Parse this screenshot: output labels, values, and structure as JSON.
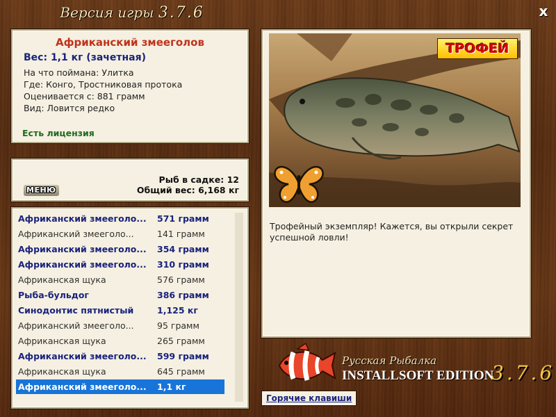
{
  "window": {
    "title": "Версия игры",
    "version": "3.7.6",
    "close_label": "x"
  },
  "fish_card": {
    "name": "Африканский змееголов",
    "weight": "Вес: 1,1 кг (зачетная)",
    "caught_on": "На что поймана: Улитка",
    "location": "Где: Конго, Тростниковая протока",
    "scored_from": "Оценивается с: 881 грамм",
    "kind": "Вид: Ловится редко",
    "license": "Есть лицензия"
  },
  "keepnet": {
    "menu_label": "МЕНЮ",
    "fish_count": "Рыб в садке: 12",
    "total_weight": "Общий вес: 6,168 кг"
  },
  "catch_list": [
    {
      "name": "Африканский змееголо...",
      "weight": "571 грамм",
      "style": "bold"
    },
    {
      "name": "Африканский змееголо...",
      "weight": "141 грамм",
      "style": "norm"
    },
    {
      "name": "Африканский змееголо...",
      "weight": "354 грамм",
      "style": "bold"
    },
    {
      "name": "Африканский змееголо...",
      "weight": "310 грамм",
      "style": "bold"
    },
    {
      "name": "Африканская щука",
      "weight": "576 грамм",
      "style": "norm"
    },
    {
      "name": "Рыба-бульдог",
      "weight": "386 грамм",
      "style": "bold"
    },
    {
      "name": "Синодонтис пятнистый",
      "weight": "1,125 кг",
      "style": "bold"
    },
    {
      "name": "Африканский змееголо...",
      "weight": "95 грамм",
      "style": "norm"
    },
    {
      "name": "Африканская щука",
      "weight": "265 грамм",
      "style": "norm"
    },
    {
      "name": "Африканский змееголо...",
      "weight": "599 грамм",
      "style": "bold"
    },
    {
      "name": "Африканская щука",
      "weight": "645 грамм",
      "style": "norm"
    },
    {
      "name": "Африканский змееголо...",
      "weight": "1,1 кг",
      "style": "sel"
    }
  ],
  "photo": {
    "badge": "ТРОФЕЙ",
    "caption": "Трофейный экземпляр! Кажется, вы открыли секрет успешной ловли!"
  },
  "branding": {
    "title": "Русская Рыбалка",
    "edition": "INSTALLSOFT EDITION",
    "version": "3.7.6"
  },
  "hotkeys_label": "Горячие клавиши",
  "colors": {
    "accent_red": "#c0331a",
    "accent_blue": "#1a237e",
    "selection": "#1874d8",
    "license_green": "#1e6b1e",
    "panel_bg": "#f5f0e1"
  },
  "icons": [
    "close-icon",
    "butterfly-icon",
    "clownfish-logo-icon"
  ]
}
